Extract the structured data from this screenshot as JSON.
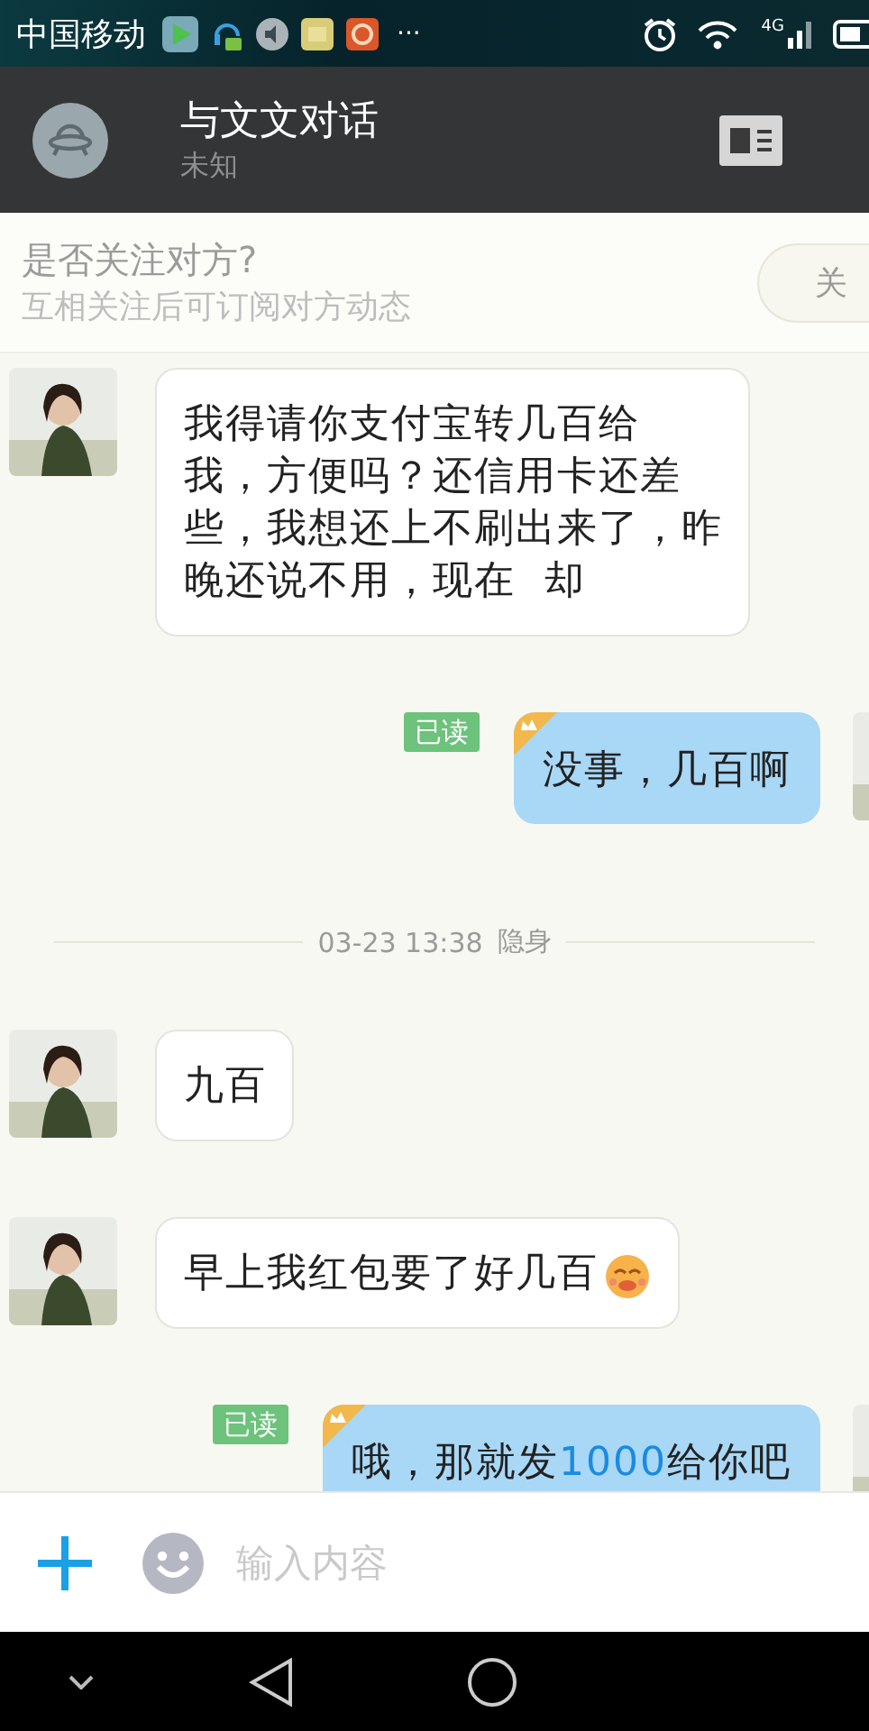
{
  "status_bar": {
    "carrier": "中国移动",
    "more": "···",
    "network": "4G"
  },
  "header": {
    "title": "与文文对话",
    "subtitle": "未知"
  },
  "follow_bar": {
    "title": "是否关注对方?",
    "subtitle": "互相关注后可订阅对方动态",
    "button": "关"
  },
  "messages": [
    {
      "kind": "incoming",
      "lines": [
        "我得请你支付宝转几百给",
        "我，方便吗？还信用卡还差",
        "些，我想还上不刷出来了，昨",
        "晚还说不用，现在  却"
      ]
    },
    {
      "kind": "outgoing",
      "read_label": "已读",
      "text": "没事，几百啊"
    },
    {
      "kind": "time",
      "time": "03-23 13:38",
      "status": "隐身"
    },
    {
      "kind": "incoming",
      "text": "九百"
    },
    {
      "kind": "incoming",
      "text": "早上我红包要了好几百",
      "emoji": true
    },
    {
      "kind": "outgoing",
      "read_label": "已读",
      "parts": [
        {
          "kind": "plain",
          "text": "哦，那就发"
        },
        {
          "kind": "number",
          "text": "1000"
        },
        {
          "kind": "plain",
          "text": "给你吧"
        }
      ]
    }
  ],
  "input_bar": {
    "placeholder": "输入内容"
  }
}
